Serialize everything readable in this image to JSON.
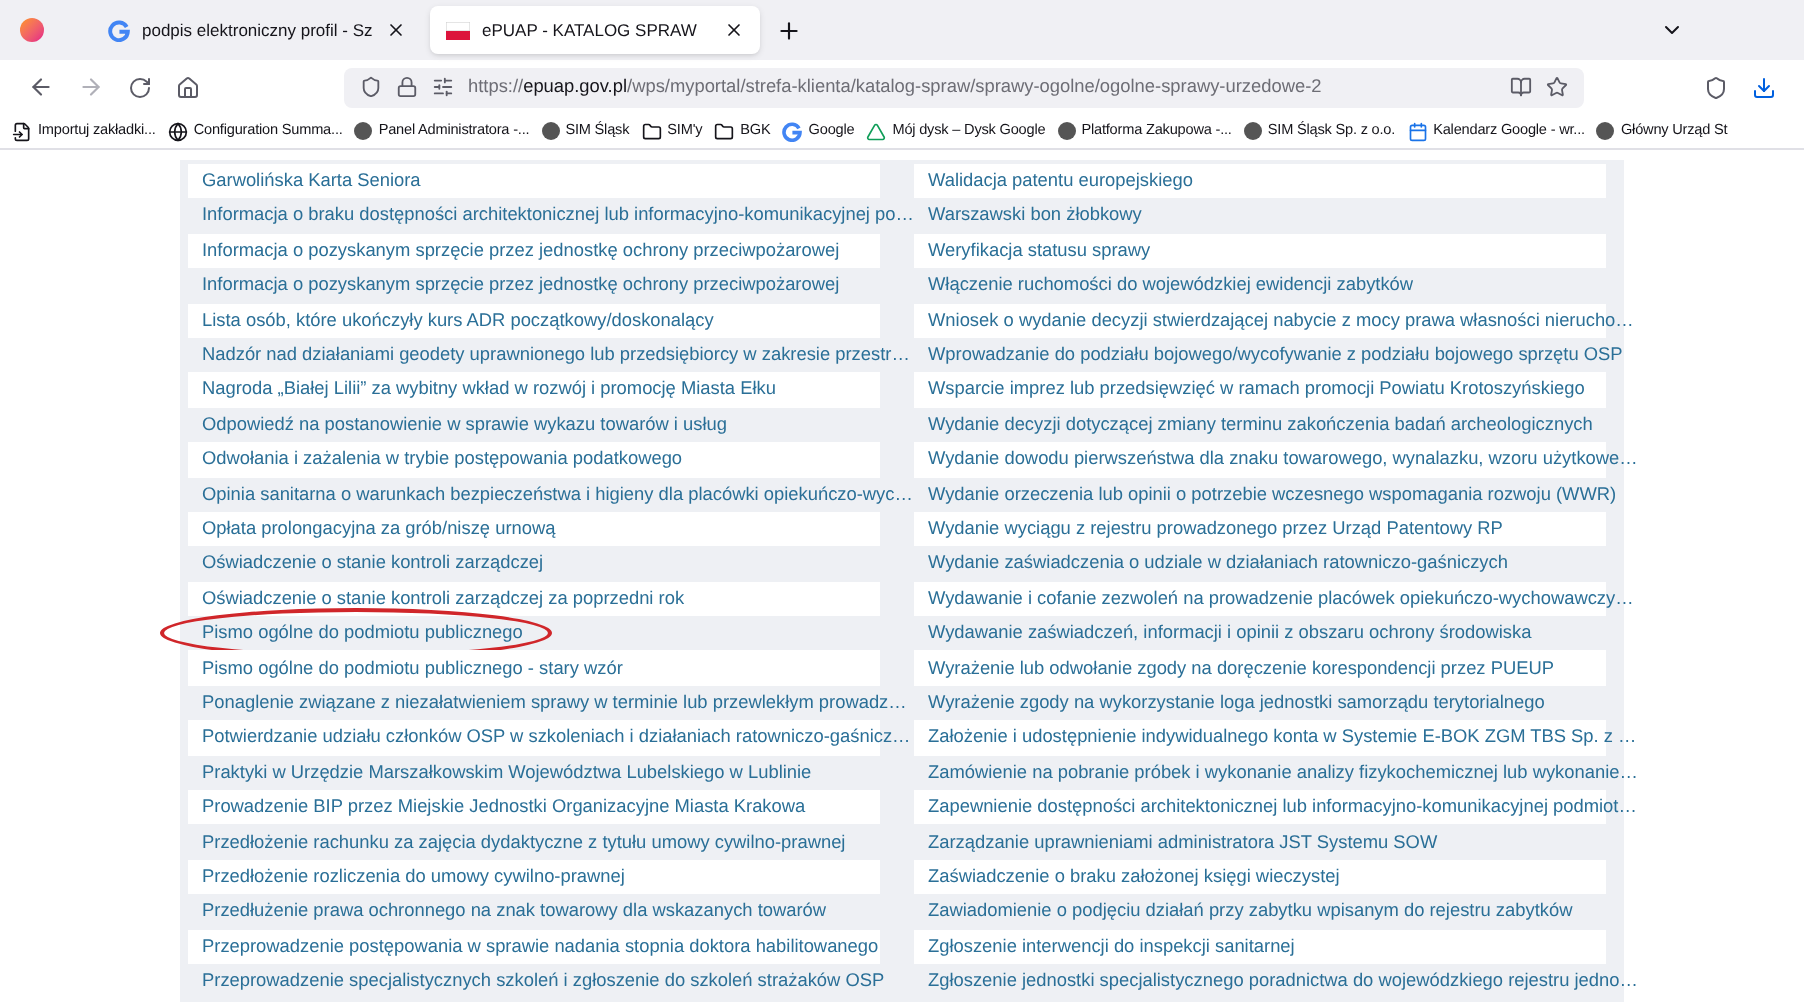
{
  "tabs": [
    {
      "title": "podpis elektroniczny profil - Sz",
      "selected": false,
      "kind": "google"
    },
    {
      "title": "ePUAP - KATALOG SPRAW",
      "selected": true,
      "kind": "epuap"
    }
  ],
  "address_bar": {
    "url_prefix": "https://",
    "url_domain": "epuap.gov.pl",
    "url_path": "/wps/myportal/strefa-klienta/katalog-spraw/sprawy-ogolne/ogolne-sprawy-urzedowe-2"
  },
  "bookmarks": [
    {
      "label": "Importuj zakładki...",
      "kind": "import"
    },
    {
      "label": "Configuration Summa...",
      "kind": "globe"
    },
    {
      "label": "Panel Administratora -...",
      "kind": "site"
    },
    {
      "label": "SIM Śląsk",
      "kind": "site"
    },
    {
      "label": "SIM'y",
      "kind": "folder"
    },
    {
      "label": "BGK",
      "kind": "folder"
    },
    {
      "label": "Google",
      "kind": "google"
    },
    {
      "label": "Mój dysk – Dysk Google",
      "kind": "drive"
    },
    {
      "label": "Platforma Zakupowa -...",
      "kind": "site"
    },
    {
      "label": "SIM Śląsk Sp. z o.o.",
      "kind": "site"
    },
    {
      "label": "Kalendarz Google - wr...",
      "kind": "calendar"
    },
    {
      "label": "Główny Urząd St",
      "kind": "site"
    }
  ],
  "catalog": {
    "left": [
      {
        "label": "Garwolińska Karta Seniora",
        "circled": false
      },
      {
        "label": "Informacja o braku dostępności architektonicznej lub informacyjno-komunikacyjnej po…",
        "circled": false
      },
      {
        "label": "Informacja o pozyskanym sprzęcie przez jednostkę ochrony przeciwpożarowej",
        "circled": false
      },
      {
        "label": "Informacja o pozyskanym sprzęcie przez jednostkę ochrony przeciwpożarowej",
        "circled": false
      },
      {
        "label": "Lista osób, które ukończyły kurs ADR początkowy/doskonalący",
        "circled": false
      },
      {
        "label": "Nadzór nad działaniami geodety uprawnionego lub przedsiębiorcy w zakresie przestr…",
        "circled": false
      },
      {
        "label": "Nagroda „Białej Lilii” za wybitny wkład w rozwój i promocję Miasta Ełku",
        "circled": false
      },
      {
        "label": "Odpowiedź na postanowienie w sprawie wykazu towarów i usług",
        "circled": false
      },
      {
        "label": "Odwołania i zażalenia w trybie postępowania podatkowego",
        "circled": false
      },
      {
        "label": "Opinia sanitarna o warunkach bezpieczeństwa i higieny dla placówki opiekuńczo-wyc…",
        "circled": false
      },
      {
        "label": "Opłata prolongacyjna za grób/niszę urnową",
        "circled": false
      },
      {
        "label": "Oświadczenie o stanie kontroli zarządczej",
        "circled": false
      },
      {
        "label": "Oświadczenie o stanie kontroli zarządczej za poprzedni rok",
        "circled": false
      },
      {
        "label": "Pismo ogólne do podmiotu publicznego",
        "circled": true
      },
      {
        "label": "Pismo ogólne do podmiotu publicznego - stary wzór",
        "circled": false
      },
      {
        "label": "Ponaglenie związane z niezałatwieniem sprawy w terminie lub przewlekłym prowadz…",
        "circled": false
      },
      {
        "label": "Potwierdzanie udziału członków OSP w szkoleniach i działaniach ratowniczo-gaśnicz…",
        "circled": false
      },
      {
        "label": "Praktyki w Urzędzie Marszałkowskim Województwa Lubelskiego w Lublinie",
        "circled": false
      },
      {
        "label": "Prowadzenie BIP przez Miejskie Jednostki Organizacyjne Miasta Krakowa",
        "circled": false
      },
      {
        "label": "Przedłożenie rachunku za zajęcia dydaktyczne z tytułu umowy cywilno-prawnej",
        "circled": false
      },
      {
        "label": "Przedłożenie rozliczenia do umowy cywilno-prawnej",
        "circled": false
      },
      {
        "label": "Przedłużenie prawa ochronnego na znak towarowy dla wskazanych towarów",
        "circled": false
      },
      {
        "label": "Przeprowadzenie postępowania w sprawie nadania stopnia doktora habilitowanego",
        "circled": false
      },
      {
        "label": "Przeprowadzenie specjalistycznych szkoleń i zgłoszenie do szkoleń strażaków OSP",
        "circled": false
      }
    ],
    "right": [
      {
        "label": "Walidacja patentu europejskiego",
        "circled": false
      },
      {
        "label": "Warszawski bon żłobkowy",
        "circled": false
      },
      {
        "label": "Weryfikacja statusu sprawy",
        "circled": false
      },
      {
        "label": "Włączenie ruchomości do wojewódzkiej ewidencji zabytków",
        "circled": false
      },
      {
        "label": "Wniosek o wydanie decyzji stwierdzającej nabycie z mocy prawa własności nierucho…",
        "circled": false
      },
      {
        "label": "Wprowadzanie do podziału bojowego/wycofywanie z podziału bojowego sprzętu OSP",
        "circled": false
      },
      {
        "label": "Wsparcie imprez lub przedsięwzięć w ramach promocji Powiatu Krotoszyńskiego",
        "circled": false
      },
      {
        "label": "Wydanie decyzji dotyczącej zmiany terminu zakończenia badań archeologicznych",
        "circled": false
      },
      {
        "label": "Wydanie dowodu pierwszeństwa dla znaku towarowego, wynalazku, wzoru użytkowe…",
        "circled": false
      },
      {
        "label": "Wydanie orzeczenia lub opinii o potrzebie wczesnego wspomagania rozwoju (WWR)",
        "circled": false
      },
      {
        "label": "Wydanie wyciągu z rejestru prowadzonego przez Urząd Patentowy RP",
        "circled": false
      },
      {
        "label": "Wydanie zaświadczenia o udziale w działaniach ratowniczo-gaśniczych",
        "circled": false
      },
      {
        "label": "Wydawanie i cofanie zezwoleń na prowadzenie placówek opiekuńczo-wychowawczy…",
        "circled": false
      },
      {
        "label": "Wydawanie zaświadczeń, informacji i opinii z obszaru ochrony środowiska",
        "circled": false
      },
      {
        "label": "Wyrażenie lub odwołanie zgody na doręczenie korespondencji przez PUEUP",
        "circled": false
      },
      {
        "label": "Wyrażenie zgody na wykorzystanie loga jednostki samorządu terytorialnego",
        "circled": false
      },
      {
        "label": "Założenie i udostępnienie indywidualnego konta w Systemie E-BOK ZGM TBS Sp. z …",
        "circled": false
      },
      {
        "label": "Zamówienie na pobranie próbek i wykonanie analizy fizykochemicznej lub wykonanie…",
        "circled": false
      },
      {
        "label": "Zapewnienie dostępności architektonicznej lub informacyjno-komunikacyjnej podmiot…",
        "circled": false
      },
      {
        "label": "Zarządzanie uprawnieniami administratora JST Systemu SOW",
        "circled": false
      },
      {
        "label": "Zaświadczenie o braku założonej księgi wieczystej",
        "circled": false
      },
      {
        "label": "Zawiadomienie o podjęciu działań przy zabytku wpisanym do rejestru zabytków",
        "circled": false
      },
      {
        "label": "Zgłoszenie interwencji do inspekcji sanitarnej",
        "circled": false
      },
      {
        "label": "Zgłoszenie jednostki specjalistycznego poradnictwa do wojewódzkiego rejestru jedno…",
        "circled": false
      }
    ]
  }
}
